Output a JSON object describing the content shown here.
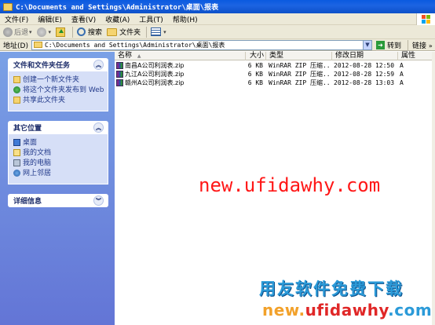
{
  "window": {
    "title": "C:\\Documents and Settings\\Administrator\\桌面\\报表"
  },
  "menu": {
    "items": [
      "文件(F)",
      "编辑(E)",
      "查看(V)",
      "收藏(A)",
      "工具(T)",
      "帮助(H)"
    ]
  },
  "toolbar": {
    "back_label": "后退",
    "search_label": "搜索",
    "folders_label": "文件夹"
  },
  "address": {
    "label": "地址(D)",
    "value": "C:\\Documents and Settings\\Administrator\\桌面\\报表",
    "go_label": "转到",
    "links_label": "链接"
  },
  "tasks_panel": {
    "title": "文件和文件夹任务",
    "items": [
      "创建一个新文件夹",
      "将这个文件夹发布到 Web",
      "共享此文件夹"
    ]
  },
  "places_panel": {
    "title": "其它位置",
    "items": [
      "桌面",
      "我的文档",
      "我的电脑",
      "网上邻居"
    ]
  },
  "details_panel": {
    "title": "详细信息"
  },
  "columns": {
    "name": "名称",
    "size": "大小",
    "type": "类型",
    "modified": "修改日期",
    "attr": "属性"
  },
  "files": [
    {
      "name": "南昌A公司利润表.zip",
      "size": "6 KB",
      "type": "WinRAR ZIP 压缩...",
      "modified": "2012-08-28 12:50",
      "attr": "A"
    },
    {
      "name": "九江A公司利润表.zip",
      "size": "6 KB",
      "type": "WinRAR ZIP 压缩...",
      "modified": "2012-08-28 12:59",
      "attr": "A"
    },
    {
      "name": "赣州A公司利润表.zip",
      "size": "6 KB",
      "type": "WinRAR ZIP 压缩...",
      "modified": "2012-08-28 13:03",
      "attr": "A"
    }
  ],
  "watermark": {
    "url": "new.ufidawhy.com",
    "cn": "用友软件免费下载",
    "url2_a": "new.",
    "url2_b": "ufidawhy",
    "url2_c": ".com"
  },
  "colors": {
    "titlebar": "#0a5ae0",
    "taskpane": "#7aa1e6",
    "watermark_red": "#ff1717",
    "watermark_blue": "#2b9ad8"
  }
}
